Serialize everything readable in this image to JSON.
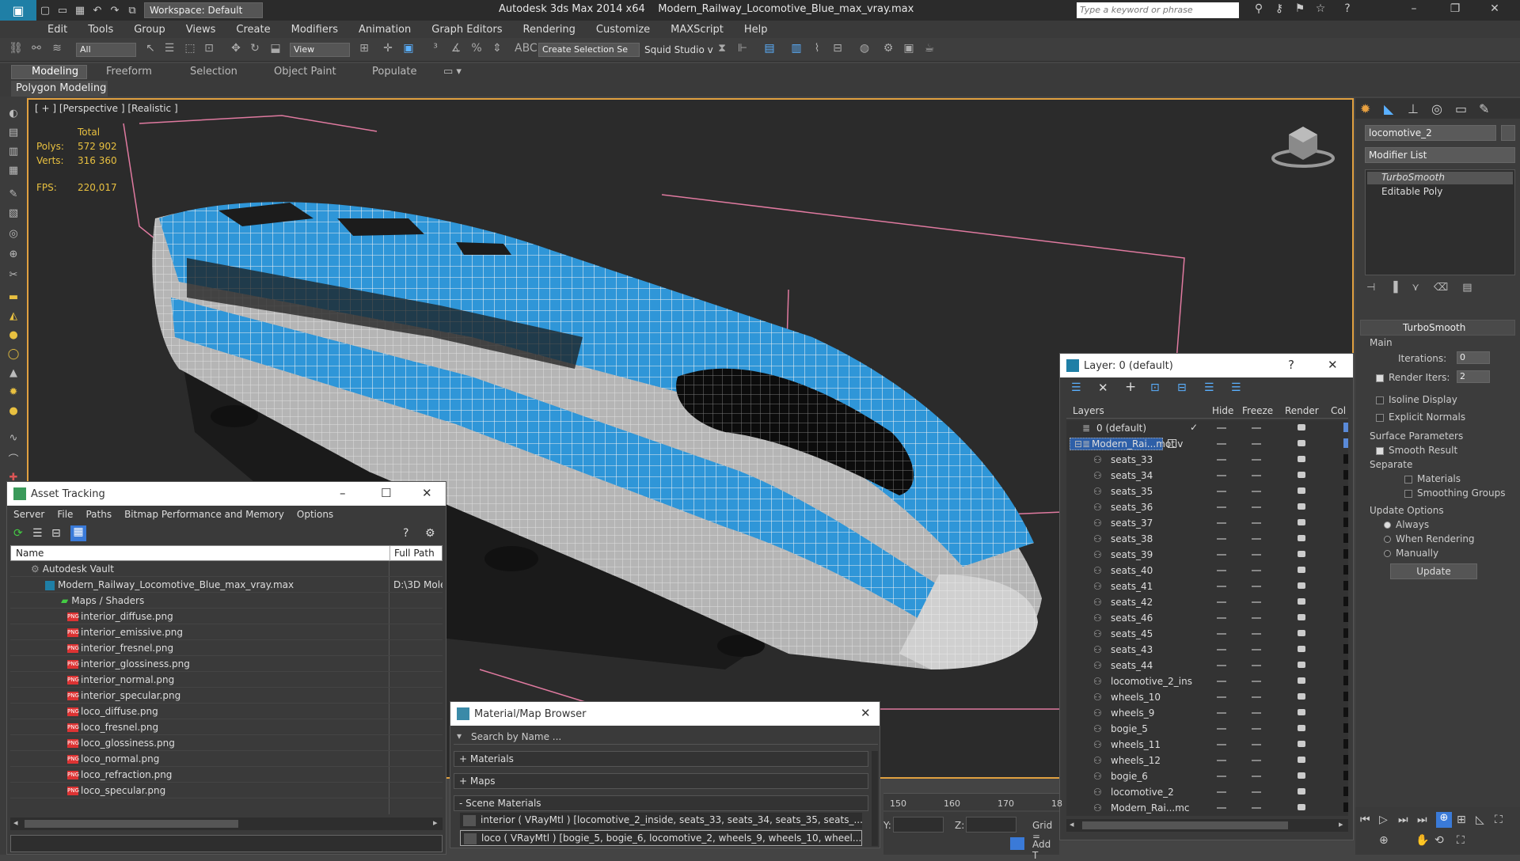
{
  "window": {
    "app_title": "Autodesk 3ds Max  2014 x64",
    "file_name": "Modern_Railway_Locomotive_Blue_max_vray.max",
    "workspace": "Workspace: Default",
    "search_placeholder": "Type a keyword or phrase"
  },
  "menu": [
    "Edit",
    "Tools",
    "Group",
    "Views",
    "Create",
    "Modifiers",
    "Animation",
    "Graph Editors",
    "Rendering",
    "Customize",
    "MAXScript",
    "Help"
  ],
  "toolbar": {
    "selection_filter": "All",
    "ref_coord": "View",
    "named_selection": "Create Selection Se",
    "squid": "Squid Studio v"
  },
  "ribbon": {
    "tabs": [
      "Modeling",
      "Freeform",
      "Selection",
      "Object Paint",
      "Populate"
    ],
    "sub_tab": "Polygon Modeling"
  },
  "viewport": {
    "label": "[ + ] [Perspective ] [Realistic ]",
    "stats_total": "Total",
    "polys_label": "Polys:",
    "polys_value": "572 902",
    "verts_label": "Verts:",
    "verts_value": "316 360",
    "fps_label": "FPS:",
    "fps_value": "220,017"
  },
  "command_panel": {
    "object_name": "locomotive_2",
    "modifier_list": "Modifier List",
    "stack": [
      "TurboSmooth",
      "Editable Poly"
    ],
    "rollout_title": "TurboSmooth",
    "main_label": "Main",
    "iterations_label": "Iterations:",
    "iterations_value": "0",
    "render_iters_label": "Render Iters:",
    "render_iters_value": "2",
    "isoline": "Isoline Display",
    "explicit_normals": "Explicit Normals",
    "surface_params": "Surface Parameters",
    "smooth_result": "Smooth Result",
    "separate": "Separate",
    "materials": "Materials",
    "smoothing_groups": "Smoothing Groups",
    "update_options": "Update Options",
    "always": "Always",
    "when_rendering": "When Rendering",
    "manually": "Manually",
    "update_button": "Update"
  },
  "layer_window": {
    "title": "Layer: 0 (default)",
    "help": "?",
    "columns": [
      "Layers",
      "Hide",
      "Freeze",
      "Render",
      "Col"
    ],
    "layers": [
      "0 (default)",
      "Modern_Rai...motiv"
    ],
    "children": [
      "seats_33",
      "seats_34",
      "seats_35",
      "seats_36",
      "seats_37",
      "seats_38",
      "seats_39",
      "seats_40",
      "seats_41",
      "seats_42",
      "seats_46",
      "seats_45",
      "seats_43",
      "seats_44",
      "locomotive_2_ins",
      "wheels_10",
      "wheels_9",
      "bogie_5",
      "wheels_11",
      "wheels_12",
      "bogie_6",
      "locomotive_2",
      "Modern_Rai...mc"
    ]
  },
  "asset_window": {
    "title": "Asset Tracking",
    "menu": [
      "Server",
      "File",
      "Paths",
      "Bitmap Performance and Memory",
      "Options"
    ],
    "col_name": "Name",
    "col_path": "Full Path",
    "vault": "Autodesk Vault",
    "max_file": "Modern_Railway_Locomotive_Blue_max_vray.max",
    "max_path": "D:\\3D Mole",
    "maps_folder": "Maps / Shaders",
    "files": [
      "interior_diffuse.png",
      "interior_emissive.png",
      "interior_fresnel.png",
      "interior_glossiness.png",
      "interior_normal.png",
      "interior_specular.png",
      "loco_diffuse.png",
      "loco_fresnel.png",
      "loco_glossiness.png",
      "loco_normal.png",
      "loco_refraction.png",
      "loco_specular.png"
    ],
    "png_badge": "PNG"
  },
  "material_browser": {
    "title": "Material/Map Browser",
    "search_placeholder": "Search by Name ...",
    "groups": [
      "+ Materials",
      "+ Maps",
      "- Scene Materials"
    ],
    "scene_materials": [
      "interior ( VRayMtl ) [locomotive_2_inside, seats_33, seats_34, seats_35, seats_...",
      "loco ( VRayMtl ) [bogie_5, bogie_6, locomotive_2, wheels_9, wheels_10, wheel..."
    ]
  },
  "timeline": {
    "ticks": [
      "150",
      "160",
      "170",
      "18"
    ],
    "y_label": "Y:",
    "z_label": "Z:",
    "grid_label": "Grid =",
    "add_t": "Add T"
  },
  "colors": {
    "train_blue": "#2f96d8",
    "wire_white": "#f0f0f0",
    "bbox_pink": "#e07aa0",
    "viewport_bg": "#2b2b2b",
    "stat_yellow": "#e8c040",
    "highlight": "#2d5fa8"
  }
}
